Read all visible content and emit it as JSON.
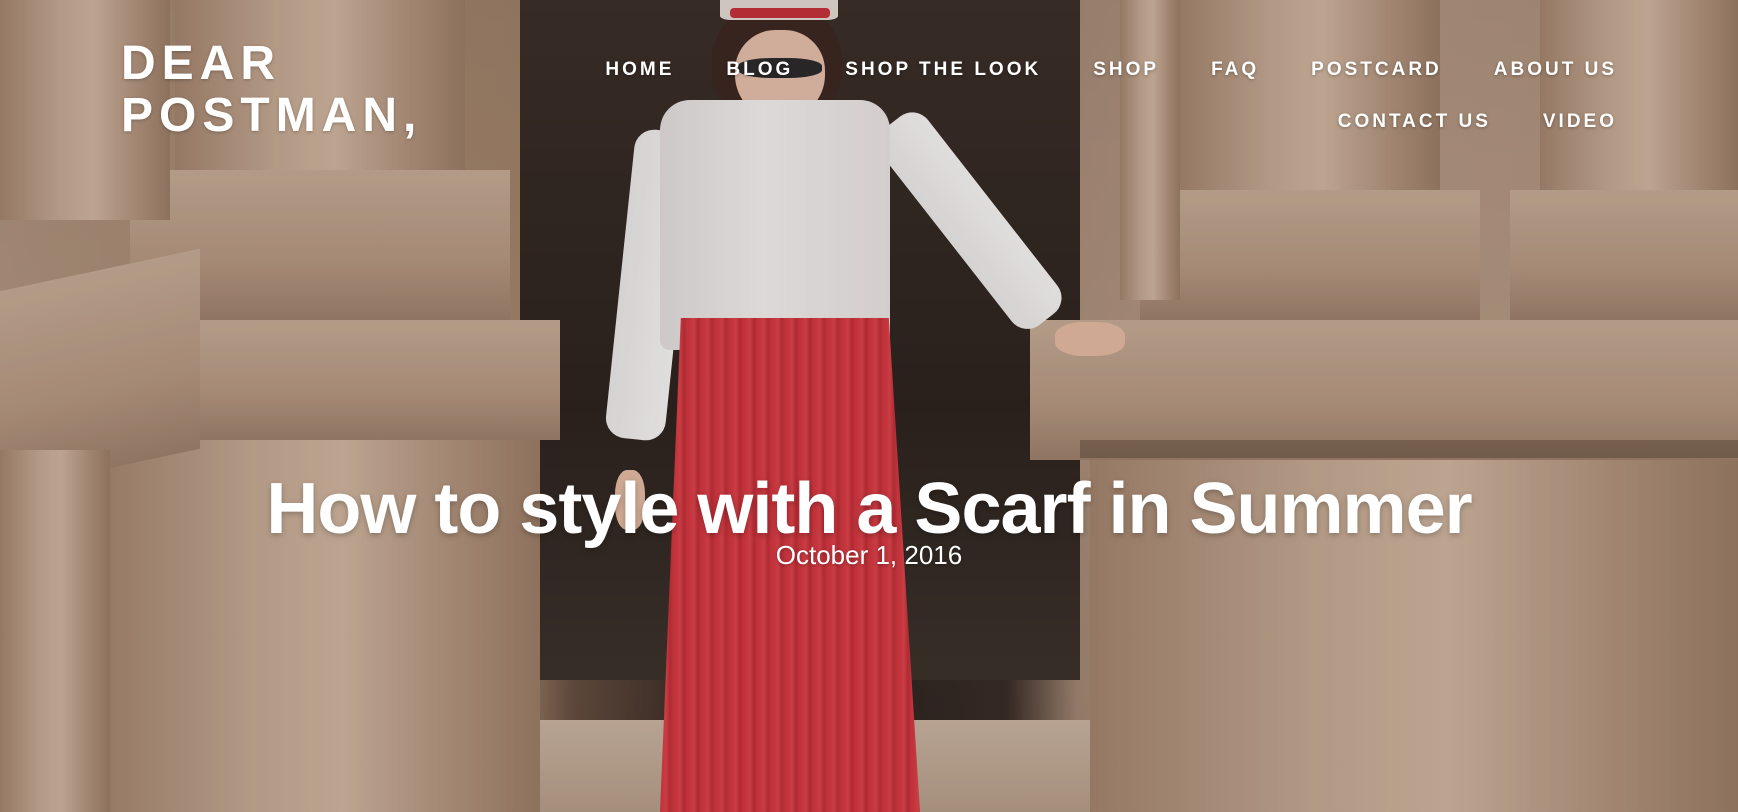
{
  "site": {
    "logo_line1": "DEAR",
    "logo_line2": "POSTMAN,"
  },
  "nav": {
    "items": [
      {
        "label": "HOME"
      },
      {
        "label": "BLOG"
      },
      {
        "label": "SHOP THE LOOK"
      },
      {
        "label": "SHOP"
      },
      {
        "label": "FAQ"
      },
      {
        "label": "POSTCARD"
      },
      {
        "label": "ABOUT US"
      },
      {
        "label": "CONTACT US"
      },
      {
        "label": "VIDEO"
      }
    ]
  },
  "post": {
    "title": "How to style with a Scarf in Summer",
    "date": "October 1, 2016"
  },
  "colors": {
    "text": "#ffffff",
    "skirt": "#d8363f",
    "stone": "#b89b84"
  }
}
